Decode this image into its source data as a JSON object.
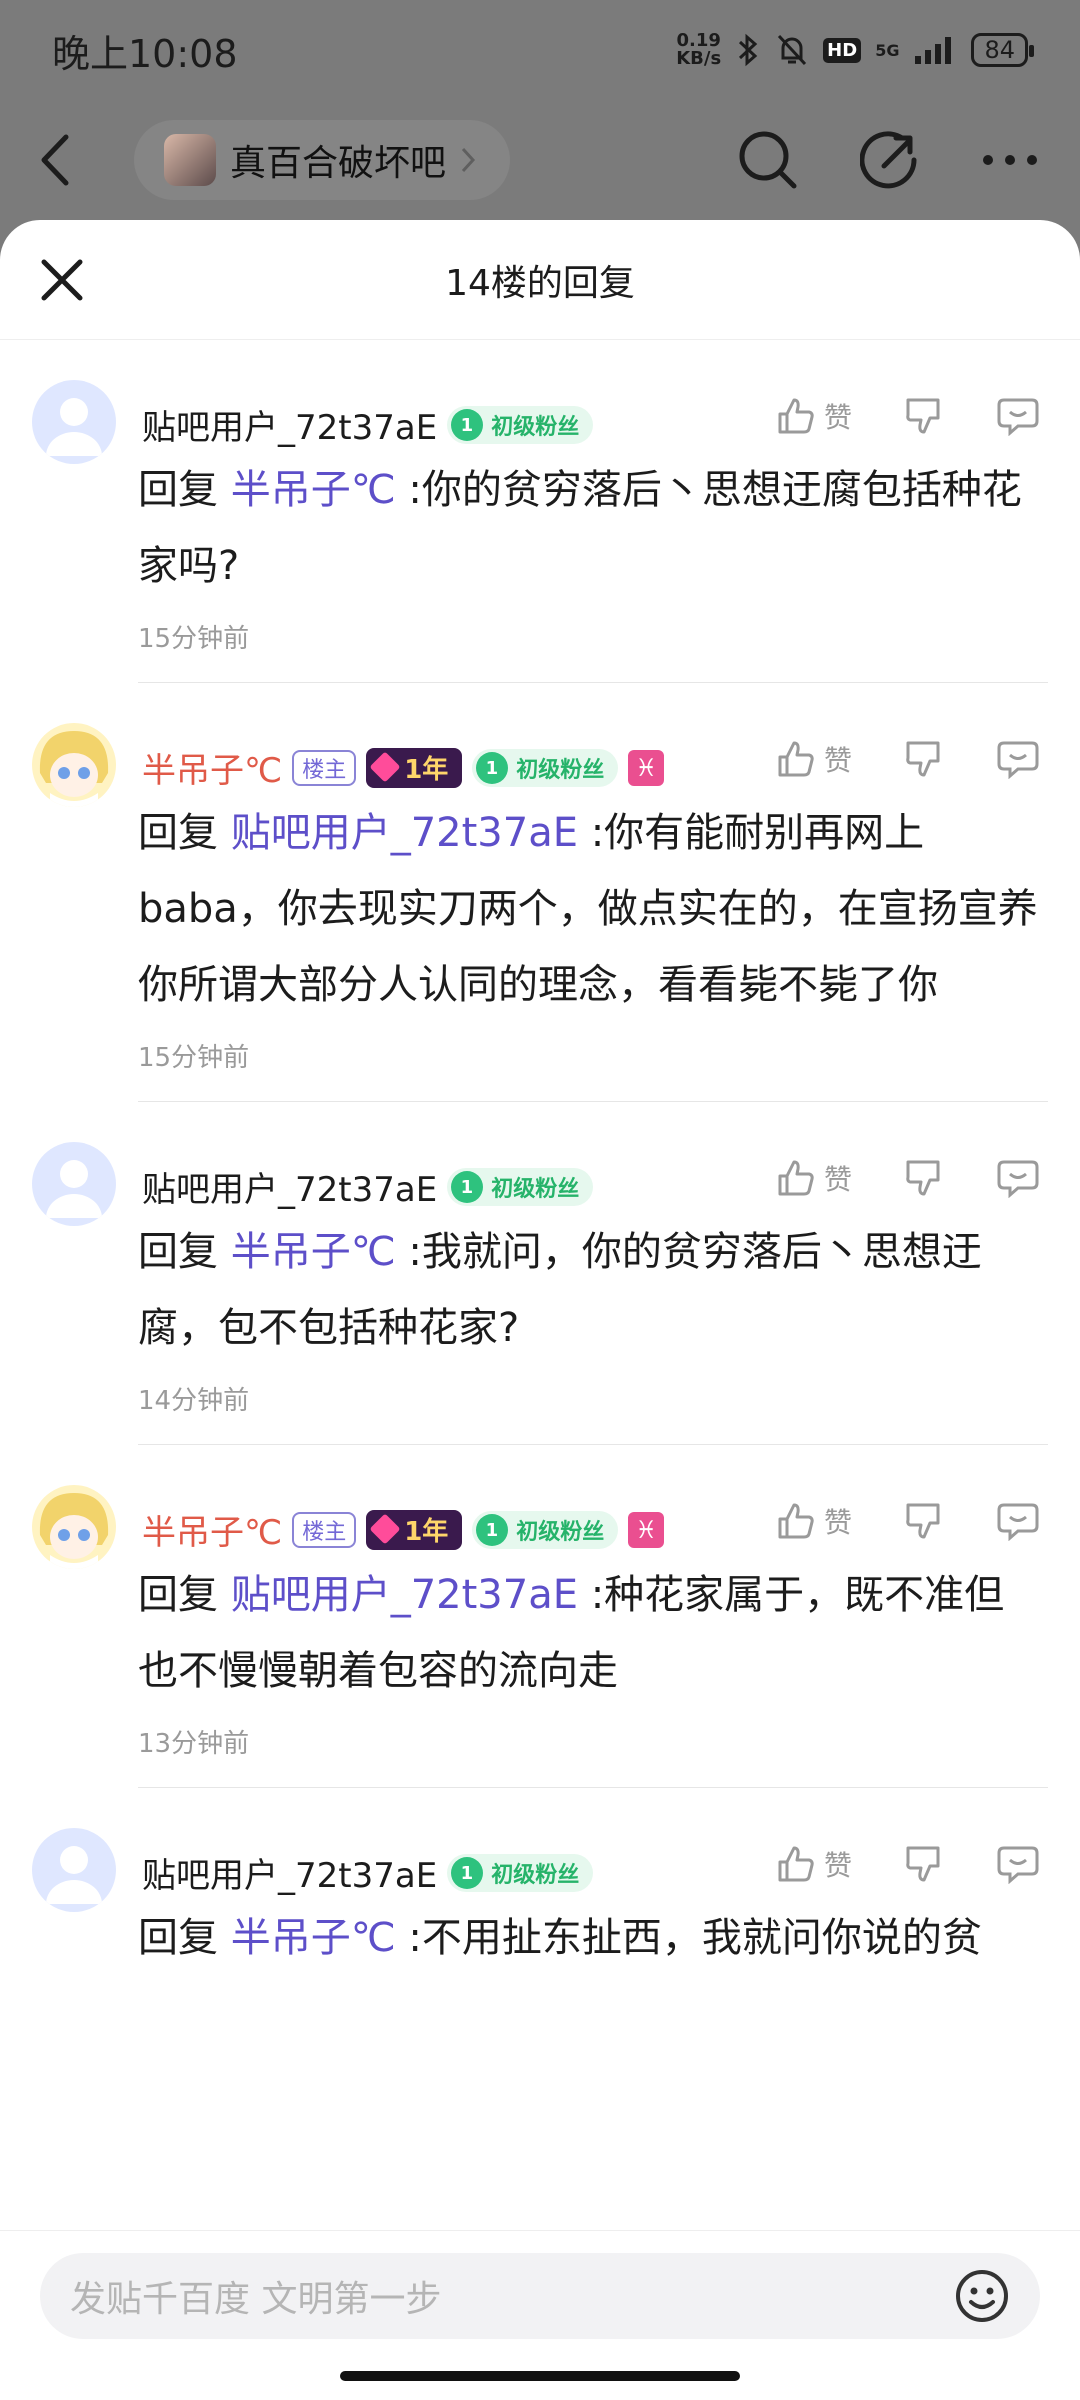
{
  "status_bar": {
    "time": "晚上10:08",
    "net_speed_value": "0.19",
    "net_speed_unit": "KB/s",
    "hd": "HD",
    "signal": "5G",
    "battery": "84"
  },
  "topbar": {
    "forum_name": "真百合破坏吧"
  },
  "sheet": {
    "title": "14楼的回复"
  },
  "badges": {
    "fan_level": "1",
    "fan_label": "初级粉丝",
    "owner_label": "楼主",
    "year_label": "1年",
    "zodiac": "♓"
  },
  "actions": {
    "like_label": "赞"
  },
  "replies": [
    {
      "user": "贴吧用户_72t37aE",
      "reply_prefix": "回复",
      "target": "半吊子℃",
      "text": ":你的贫穷落后丶思想迂腐包括种花家吗?",
      "time": "15分钟前"
    },
    {
      "user": "半吊子℃",
      "reply_prefix": "回复",
      "target": "贴吧用户_72t37aE",
      "text": ":你有能耐别再网上baba，你去现实刀两个，做点实在的，在宣扬宣养你所谓大部分人认同的理念，看看毙不毙了你",
      "time": "15分钟前"
    },
    {
      "user": "贴吧用户_72t37aE",
      "reply_prefix": "回复",
      "target": "半吊子℃",
      "text": ":我就问，你的贫穷落后丶思想迂腐，包不包括种花家?",
      "time": "14分钟前"
    },
    {
      "user": "半吊子℃",
      "reply_prefix": "回复",
      "target": "贴吧用户_72t37aE",
      "text": ":种花家属于，既不准但也不慢慢朝着包容的流向走",
      "time": "13分钟前"
    },
    {
      "user": "贴吧用户_72t37aE",
      "reply_prefix": "回复",
      "target": "半吊子℃",
      "text": ":不用扯东扯西，我就问你说的贫"
    }
  ],
  "input": {
    "placeholder": "发贴千百度 文明第一步"
  }
}
